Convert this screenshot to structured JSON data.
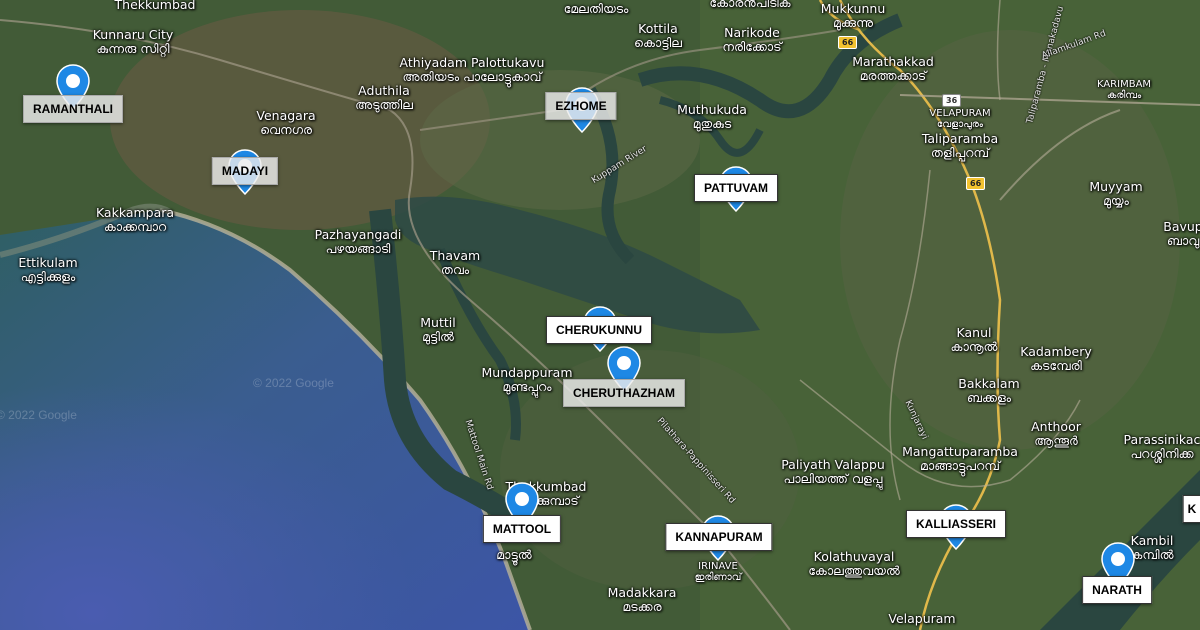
{
  "map": {
    "places": [
      {
        "id": "thekkumbad-top",
        "en": "Thekkumbad",
        "ml": ""
      },
      {
        "id": "kunnaru-city",
        "en": "Kunnaru City",
        "ml": "കുന്നരു സിറ്റി"
      },
      {
        "id": "athiyadam",
        "en": "Athiyadam Palottukavu",
        "ml": "അതിയടം പാലോട്ടുകാവ്"
      },
      {
        "id": "kottila",
        "en": "Kottila",
        "ml": "കൊട്ടില"
      },
      {
        "id": "narikode",
        "en": "Narikode",
        "ml": "നരിക്കോട്"
      },
      {
        "id": "mukkunnu",
        "en": "Mukkunnu",
        "ml": "മുക്കുന്നു"
      },
      {
        "id": "marathakkad",
        "en": "Marathakkad",
        "ml": "മരത്തക്കാട്"
      },
      {
        "id": "aduthila",
        "en": "Aduthila",
        "ml": "അടുത്തില"
      },
      {
        "id": "venagara",
        "en": "Venagara",
        "ml": "വെനഗര"
      },
      {
        "id": "muthukuda",
        "en": "Muthukuda",
        "ml": "മുതുകുട"
      },
      {
        "id": "taliparamba",
        "en": "Taliparamba",
        "ml": "തളിപ്പറമ്പ്"
      },
      {
        "id": "velapuram-top",
        "en": "VELAPURAM",
        "ml": "വേളാപുരം"
      },
      {
        "id": "karimbam",
        "en": "KARIMBAM",
        "ml": "കരിമ്പം"
      },
      {
        "id": "kakkampara",
        "en": "Kakkampara",
        "ml": "കാക്കമ്പാറ"
      },
      {
        "id": "ettikulam",
        "en": "Ettikulam",
        "ml": "എട്ടിക്കുളം"
      },
      {
        "id": "pazhayangadi",
        "en": "Pazhayangadi",
        "ml": "പഴയങ്ങാടി"
      },
      {
        "id": "thavam",
        "en": "Thavam",
        "ml": "തവം"
      },
      {
        "id": "muyyam",
        "en": "Muyyam",
        "ml": "മുയ്യം"
      },
      {
        "id": "bavupa",
        "en": "Bavup",
        "ml": "ബാവു"
      },
      {
        "id": "muttil",
        "en": "Muttil",
        "ml": "മുട്ടിൽ"
      },
      {
        "id": "kanul",
        "en": "Kanul",
        "ml": "കാനൂൽ"
      },
      {
        "id": "kadambery",
        "en": "Kadambery",
        "ml": "കടമ്പേരി"
      },
      {
        "id": "mundappuram",
        "en": "Mundappuram",
        "ml": "മുണ്ടപ്പുറം"
      },
      {
        "id": "bakkalam",
        "en": "Bakkalam",
        "ml": "ബക്കളം"
      },
      {
        "id": "anthoor",
        "en": "Anthoor",
        "ml": "ആന്തൂർ"
      },
      {
        "id": "parassinikadavu",
        "en": "Parassinikac",
        "ml": "പറശ്ശിനിക്ക"
      },
      {
        "id": "mangattuparamba",
        "en": "Mangattuparamba",
        "ml": "മാങ്ങാട്ടുപറമ്പ്"
      },
      {
        "id": "paliyath",
        "en": "Paliyath Valappu",
        "ml": "പാലിയത്ത് വളപ്പു"
      },
      {
        "id": "thekkumbad",
        "en": "Thekkumbad",
        "ml": "തെക്കുമ്പാട്"
      },
      {
        "id": "mattool-town",
        "en": "",
        "ml": "മാട്ടൂൽ"
      },
      {
        "id": "kambil",
        "en": "Kambil",
        "ml": "കമ്പിൽ"
      },
      {
        "id": "irinave",
        "en": "IRINAVE",
        "ml": "ഇരിണാവ്"
      },
      {
        "id": "kolathuvayal",
        "en": "Kolathuvayal",
        "ml": "കോലത്തുവയൽ"
      },
      {
        "id": "madakkara",
        "en": "Madakkara",
        "ml": "മടക്കര"
      },
      {
        "id": "velapuram-bottom",
        "en": "Velapuram",
        "ml": ""
      },
      {
        "id": "top-ml-1",
        "en": "",
        "ml": "മേലതിയടം"
      },
      {
        "id": "top-ml-2",
        "en": "",
        "ml": "കോരൻപീടിക"
      }
    ],
    "roads": [
      {
        "id": "kuppam-river",
        "text": "Kuppam River"
      },
      {
        "id": "mattool-main-rd",
        "text": "Mattool Main Rd"
      },
      {
        "id": "pilathara-rd",
        "text": "Pilathara-Pappinisseri Rd"
      },
      {
        "id": "kunjarayi",
        "text": "Kunjarayi"
      },
      {
        "id": "taliparamba-rd",
        "text": "Taliparamba - Manakadavu"
      },
      {
        "id": "allamkulam-rd",
        "text": "Allamkulam Rd"
      }
    ],
    "shields": [
      {
        "id": "nh66-a",
        "text": "66"
      },
      {
        "id": "sh36",
        "text": "36"
      },
      {
        "id": "nh66-b",
        "text": "66"
      }
    ],
    "copyright": "© 2022 Google"
  },
  "markers": [
    {
      "id": "ramanthali",
      "label": "RAMANTHALI"
    },
    {
      "id": "madayi",
      "label": "MADAYI"
    },
    {
      "id": "ezhome",
      "label": "EZHOME"
    },
    {
      "id": "pattuvam",
      "label": "PATTUVAM"
    },
    {
      "id": "cherukunnu",
      "label": "CHERUKUNNU"
    },
    {
      "id": "cheruthazham",
      "label": "CHERUTHAZHAM"
    },
    {
      "id": "mattool",
      "label": "MATTOOL"
    },
    {
      "id": "kannapuram",
      "label": "KANNAPURAM"
    },
    {
      "id": "kalliasseri",
      "label": "KALLIASSERI"
    },
    {
      "id": "narath",
      "label": "NARATH"
    },
    {
      "id": "edge-marker",
      "label": "K"
    }
  ],
  "colors": {
    "pin": "#1e88e5",
    "sea": "#3b58a8",
    "land": "#3f5a34",
    "river": "#2a4640"
  }
}
